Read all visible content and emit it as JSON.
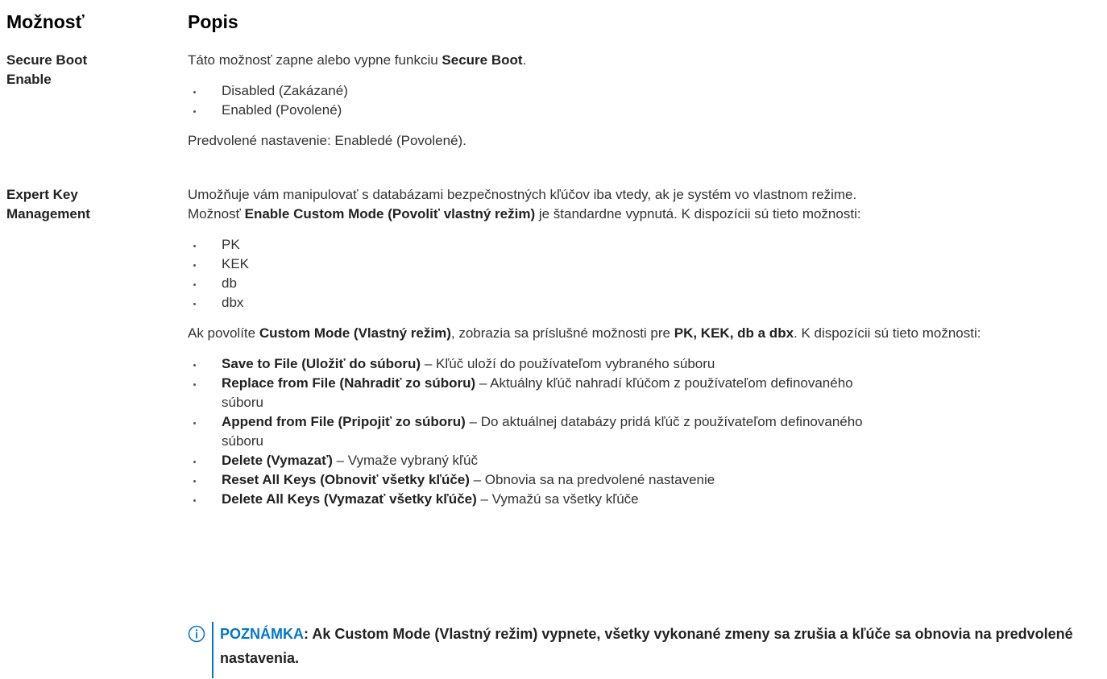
{
  "header": {
    "option": "Možnosť",
    "description": "Popis"
  },
  "rows": [
    {
      "name_line1": "Secure Boot",
      "name_line2": "Enable",
      "intro_pre": "Táto možnosť zapne alebo vypne funkciu ",
      "intro_bold": "Secure Boot",
      "intro_post": ".",
      "items": [
        "Disabled (Zakázané)",
        "Enabled (Povolené)"
      ],
      "default_text": "Predvolené nastavenie: Enabledé (Povolené)."
    },
    {
      "name_line1": "Expert Key",
      "name_line2": "Management",
      "p1_line1": "Umožňuje vám manipulovať s databázami bezpečnostných kľúčov iba vtedy, ak je systém vo vlastnom režime.",
      "p1_line2_pre": "Možnosť ",
      "p1_line2_bold": "Enable Custom Mode (Povoliť vlastný režim)",
      "p1_line2_post": " je štandardne vypnutá. K dispozícii sú tieto možnosti:",
      "keys": [
        "PK",
        "KEK",
        "db",
        "dbx"
      ],
      "p2_pre": "Ak povolíte ",
      "p2_bold1": "Custom Mode (Vlastný režim)",
      "p2_mid": ", zobrazia sa príslušné možnosti pre ",
      "p2_bold2": "PK, KEK, db a dbx",
      "p2_post": ". K dispozícii sú tieto možnosti:",
      "actions": [
        {
          "bold": "Save to File (Uložiť do súboru)",
          "text": " – Kľúč uloží do používateľom vybraného súboru"
        },
        {
          "bold": "Replace from File (Nahradiť zo súboru)",
          "text": " – Aktuálny kľúč nahradí kľúčom z používateľom definovaného súboru"
        },
        {
          "bold": "Append from File (Pripojiť zo súboru)",
          "text": " – Do aktuálnej databázy pridá kľúč z používateľom definovaného súboru"
        },
        {
          "bold": "Delete (Vymazať)",
          "text": " – Vymaže vybraný kľúč"
        },
        {
          "bold": "Reset All Keys (Obnoviť všetky kľúče)",
          "text": " – Obnovia sa na predvolené nastavenie"
        },
        {
          "bold": "Delete All Keys (Vymazať všetky kľúče)",
          "text": " – Vymažú sa všetky kľúče"
        }
      ]
    }
  ],
  "note": {
    "label": "POZNÁMKA",
    "text": ": Ak Custom Mode (Vlastný režim) vypnete, všetky vykonané zmeny sa zrušia a kľúče sa obnovia na predvolené nastavenia."
  },
  "colors": {
    "accent": "#0076ce",
    "text": "#333333",
    "heading": "#000000"
  },
  "icons": {
    "note": "info-circle-icon"
  }
}
